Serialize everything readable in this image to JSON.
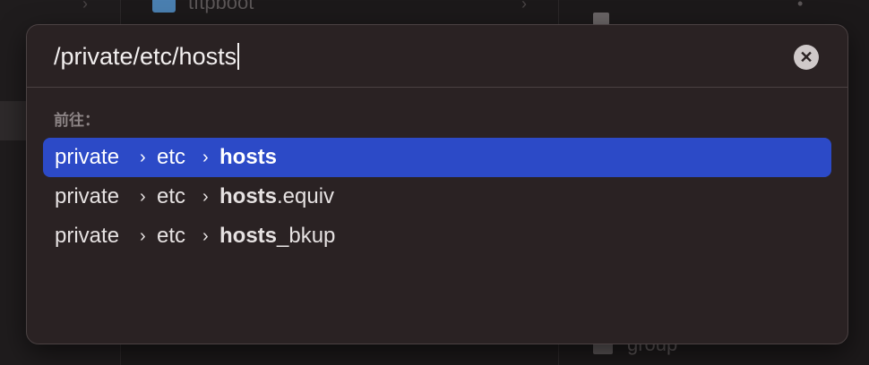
{
  "background": {
    "folder_label": "tftpboot",
    "file_label": "group"
  },
  "go_to_folder": {
    "path_value": "/private/etc/hosts",
    "clear_icon": "clear-circle-icon",
    "section_label": "前往：",
    "results": [
      {
        "parts": [
          "private",
          "etc"
        ],
        "match": "hosts",
        "suffix": "",
        "selected": true
      },
      {
        "parts": [
          "private",
          "etc"
        ],
        "match": "hosts",
        "suffix": ".equiv",
        "selected": false
      },
      {
        "parts": [
          "private",
          "etc"
        ],
        "match": "hosts",
        "suffix": "_bkup",
        "selected": false
      }
    ],
    "separator": "›"
  },
  "colors": {
    "selection": "#2c4ac7",
    "panel": "#2a2223"
  }
}
